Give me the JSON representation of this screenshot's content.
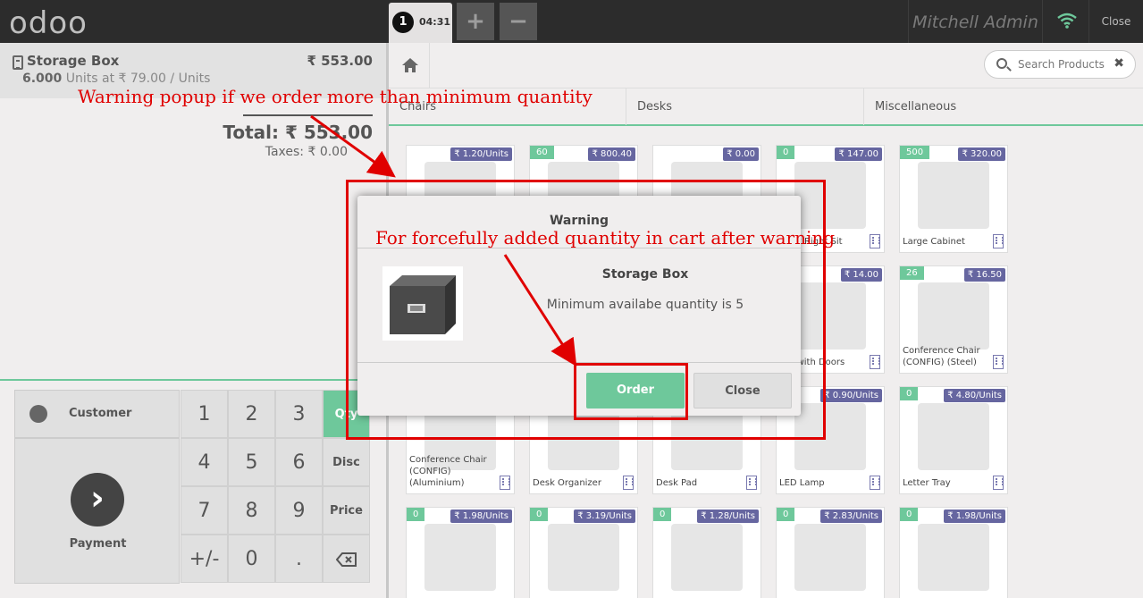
{
  "brand": "odoo",
  "topbar": {
    "order_number": "1",
    "order_time": "04:31",
    "add_label": "+",
    "remove_label": "−",
    "user_name": "Mitchell Admin",
    "close_label": "Close"
  },
  "orderline": {
    "product": "Storage Box",
    "price": "₹ 553.00",
    "quantity": "6.000",
    "unit_info": "Units at ₹ 79.00 / Units"
  },
  "summary": {
    "total": "Total: ₹ 553.00",
    "taxes": "Taxes: ₹ 0.00"
  },
  "actionpad": {
    "customer_label": "Customer",
    "payment_label": "Payment"
  },
  "numpad": {
    "keys": [
      "1",
      "2",
      "3",
      "4",
      "5",
      "6",
      "7",
      "8",
      "9",
      "+/-",
      "0",
      "."
    ],
    "qty_label": "Qty",
    "disc_label": "Disc",
    "price_label": "Price"
  },
  "search": {
    "placeholder": "Search Products",
    "clear": "✖"
  },
  "categories": [
    "Chairs",
    "Desks",
    "Miscellaneous"
  ],
  "products": [
    {
      "name": "",
      "price": "₹ 1.20/Units",
      "qty": ""
    },
    {
      "name": "",
      "price": "₹ 800.40",
      "qty": "60"
    },
    {
      "name": "",
      "price": "₹ 0.00",
      "qty": ""
    },
    {
      "name": "Desk Right Sit",
      "price": "₹ 147.00",
      "qty": "0"
    },
    {
      "name": "Large Cabinet",
      "price": "₹ 320.00",
      "qty": "500"
    },
    {
      "name": "",
      "price": "",
      "qty": ""
    },
    {
      "name": "",
      "price": "",
      "qty": ""
    },
    {
      "name": "",
      "price": "",
      "qty": ""
    },
    {
      "name": "net with Doors",
      "price": "₹ 14.00",
      "qty": ""
    },
    {
      "name": "Conference Chair (CONFIG) (Steel)",
      "price": "₹ 16.50",
      "qty": "26"
    },
    {
      "name": "Conference Chair (CONFIG) (Aluminium)",
      "price": "",
      "qty": ""
    },
    {
      "name": "Desk Organizer",
      "price": "",
      "qty": ""
    },
    {
      "name": "Desk Pad",
      "price": "",
      "qty": ""
    },
    {
      "name": "LED Lamp",
      "price": "₹ 0.90/Units",
      "qty": ""
    },
    {
      "name": "Letter Tray",
      "price": "₹ 4.80/Units",
      "qty": "0"
    },
    {
      "name": "",
      "price": "₹ 1.98/Units",
      "qty": "0"
    },
    {
      "name": "",
      "price": "₹ 3.19/Units",
      "qty": "0"
    },
    {
      "name": "",
      "price": "₹ 1.28/Units",
      "qty": "0"
    },
    {
      "name": "",
      "price": "₹ 2.83/Units",
      "qty": "0"
    },
    {
      "name": "",
      "price": "₹ 1.98/Units",
      "qty": "0"
    }
  ],
  "modal": {
    "title": "Warning",
    "product": "Storage Box",
    "message": "Minimum availabe quantity is 5",
    "order_label": "Order",
    "close_label": "Close"
  },
  "annotations": {
    "top": "Warning popup if we order more than minimum quantity",
    "middle": "For forcefully added quantity in cart after warning",
    "color": "#e00000"
  }
}
